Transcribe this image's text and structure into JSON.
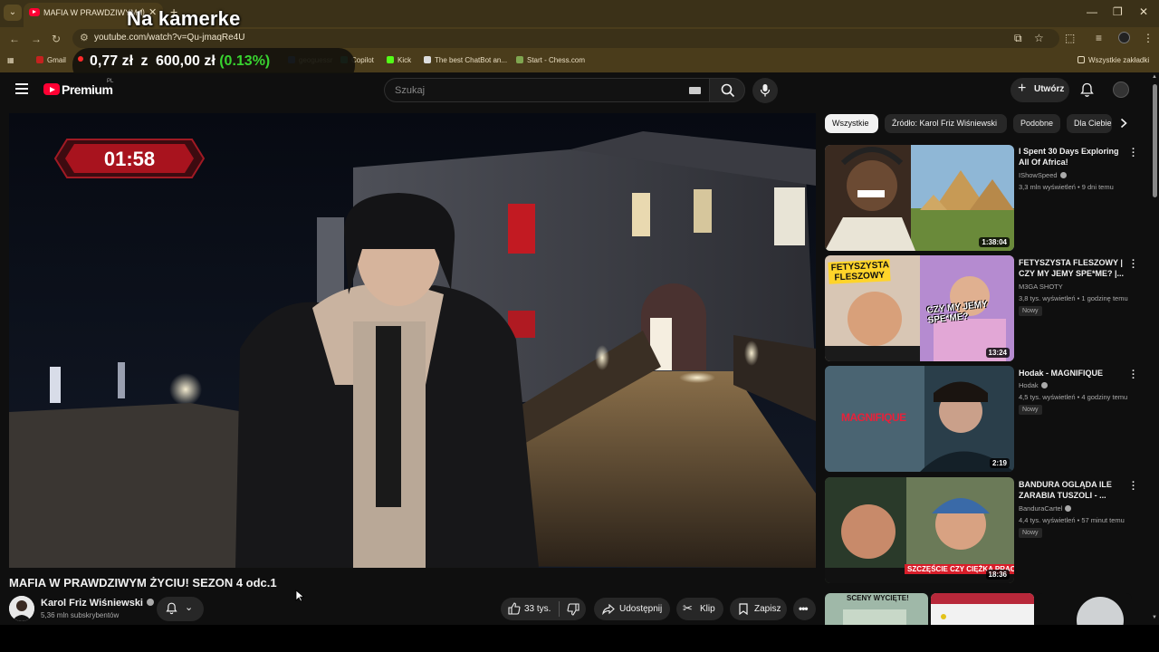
{
  "browser": {
    "tab_title": "MAFIA W PRAWDZIWYM ŻYCIU! SEZON 4 odc.1 - YouTube",
    "url": "youtube.com/watch?v=Qu-jmaqRe4U",
    "new_tab_icon": "plus-icon",
    "bookmarks": [
      "Gmail",
      "geoguessr",
      "Copilot",
      "Kick",
      "The best ChatBot an...",
      "Start - Chess.com"
    ],
    "all_bookmarks": "Wszystkie zakładki"
  },
  "stream_overlay": {
    "title": "Na kamerke",
    "amount": "0,77 zł",
    "of": "z",
    "goal": "600,00 zł",
    "percent": "(0.13%)"
  },
  "youtube": {
    "brand": "Premium",
    "region": "PL",
    "search_placeholder": "Szukaj",
    "create_label": "Utwórz"
  },
  "video": {
    "timer": "01:58",
    "title": "MAFIA W PRAWDZIWYM ŻYCIU! SEZON 4 odc.1",
    "channel": "Karol Friz Wiśniewski",
    "subscribers": "5,36 mln subskrybentów",
    "likes": "33 tys.",
    "share_label": "Udostępnij",
    "clip_label": "Klip",
    "save_label": "Zapisz"
  },
  "chips": [
    "Wszystkie",
    "Źródło: Karol Friz Wiśniewski",
    "Podobne",
    "Dla Ciebie"
  ],
  "recommendations": [
    {
      "title": "I Spent 30 Days Exploring All Of Africa!",
      "channel": "IShowSpeed",
      "views": "3,3 mln wyświetleń",
      "age": "9 dni temu",
      "duration": "1:38:04",
      "badge": ""
    },
    {
      "title": "FETYSZYSTA FLESZOWY | CZY MY JEMY SPE*ME? |...",
      "channel": "M3GA SHOTY",
      "views": "3,8 tys. wyświetleń",
      "age": "1 godzinę temu",
      "duration": "13:24",
      "badge": "Nowy"
    },
    {
      "title": "Hodak - MAGNIFIQUE",
      "channel": "Hodak",
      "views": "4,5 tys. wyświetleń",
      "age": "4 godziny temu",
      "duration": "2:19",
      "badge": "Nowy"
    },
    {
      "title": "BANDURA OGLĄDA ILE ZARABIA TUSZOLI - ...",
      "channel": "BanduraCartel",
      "views": "4,4 tys. wyświetleń",
      "age": "57 minut temu",
      "duration": "18:36",
      "badge": "Nowy"
    }
  ],
  "thumb_text": {
    "fetysz": "FETYSZYSTA FLESZOWY",
    "czy_my": "CZY MY JEMY SPE*ME?",
    "magnifique": "MAGNIFIQUE",
    "szczescie": "SZCZĘŚCIE CZY CIĘŻKA PRACA?",
    "sceny": "SCENY WYCIĘTE!"
  },
  "colors": {
    "accent": "#ff0033",
    "ticker_green": "#38d430"
  }
}
